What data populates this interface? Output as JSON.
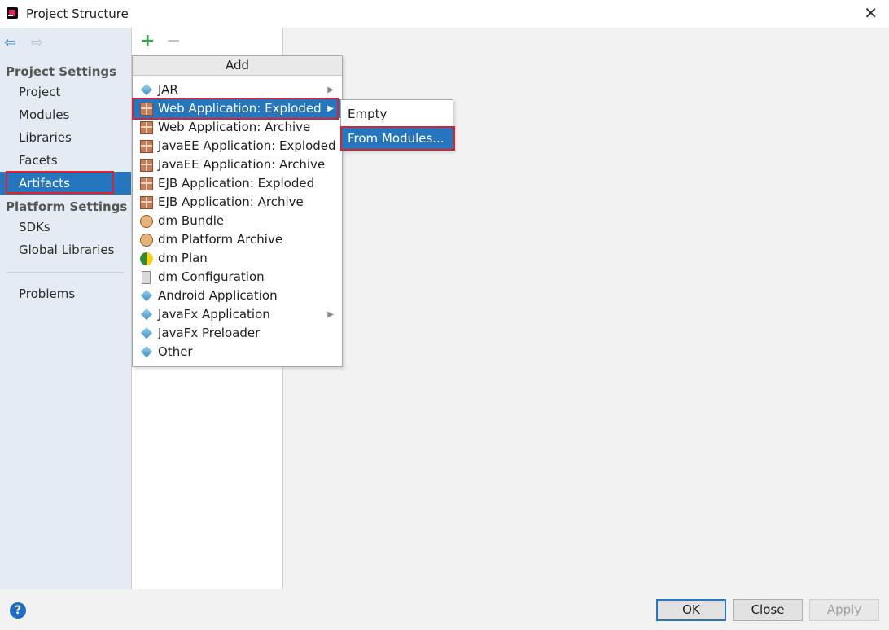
{
  "window": {
    "title": "Project Structure",
    "close_glyph": "✕"
  },
  "sidebar": {
    "project_settings_header": "Project Settings",
    "project_items": [
      "Project",
      "Modules",
      "Libraries",
      "Facets",
      "Artifacts"
    ],
    "platform_settings_header": "Platform Settings",
    "platform_items": [
      "SDKs",
      "Global Libraries"
    ],
    "problems_label": "Problems",
    "selected_item": "Artifacts"
  },
  "toolbar": {
    "add_glyph": "+",
    "remove_glyph": "−"
  },
  "add_popup": {
    "header": "Add",
    "items": [
      {
        "label": "JAR",
        "icon": "diamond-icon",
        "has_submenu": true
      },
      {
        "label": "Web Application: Exploded",
        "icon": "gift-icon",
        "has_submenu": true,
        "highlighted": true
      },
      {
        "label": "Web Application: Archive",
        "icon": "gift-icon"
      },
      {
        "label": "JavaEE Application: Exploded",
        "icon": "gift-icon"
      },
      {
        "label": "JavaEE Application: Archive",
        "icon": "gift-icon"
      },
      {
        "label": "EJB Application: Exploded",
        "icon": "gift-icon"
      },
      {
        "label": "EJB Application: Archive",
        "icon": "gift-icon"
      },
      {
        "label": "dm Bundle",
        "icon": "bundle-icon"
      },
      {
        "label": "dm Platform Archive",
        "icon": "bundle-icon"
      },
      {
        "label": "dm Plan",
        "icon": "plan-icon"
      },
      {
        "label": "dm Configuration",
        "icon": "document-icon"
      },
      {
        "label": "Android Application",
        "icon": "diamond-icon"
      },
      {
        "label": "JavaFx Application",
        "icon": "diamond-icon",
        "has_submenu": true
      },
      {
        "label": "JavaFx Preloader",
        "icon": "diamond-icon"
      },
      {
        "label": "Other",
        "icon": "diamond-icon"
      }
    ]
  },
  "submenu": {
    "items": [
      "Empty",
      "From Modules..."
    ],
    "highlighted": "From Modules..."
  },
  "buttons": {
    "ok": "OK",
    "close": "Close",
    "apply": "Apply",
    "help": "?"
  },
  "colors": {
    "selection": "#2675bf",
    "annotation_box": "#e0202a",
    "sidebar_bg": "#e4ebf2"
  }
}
